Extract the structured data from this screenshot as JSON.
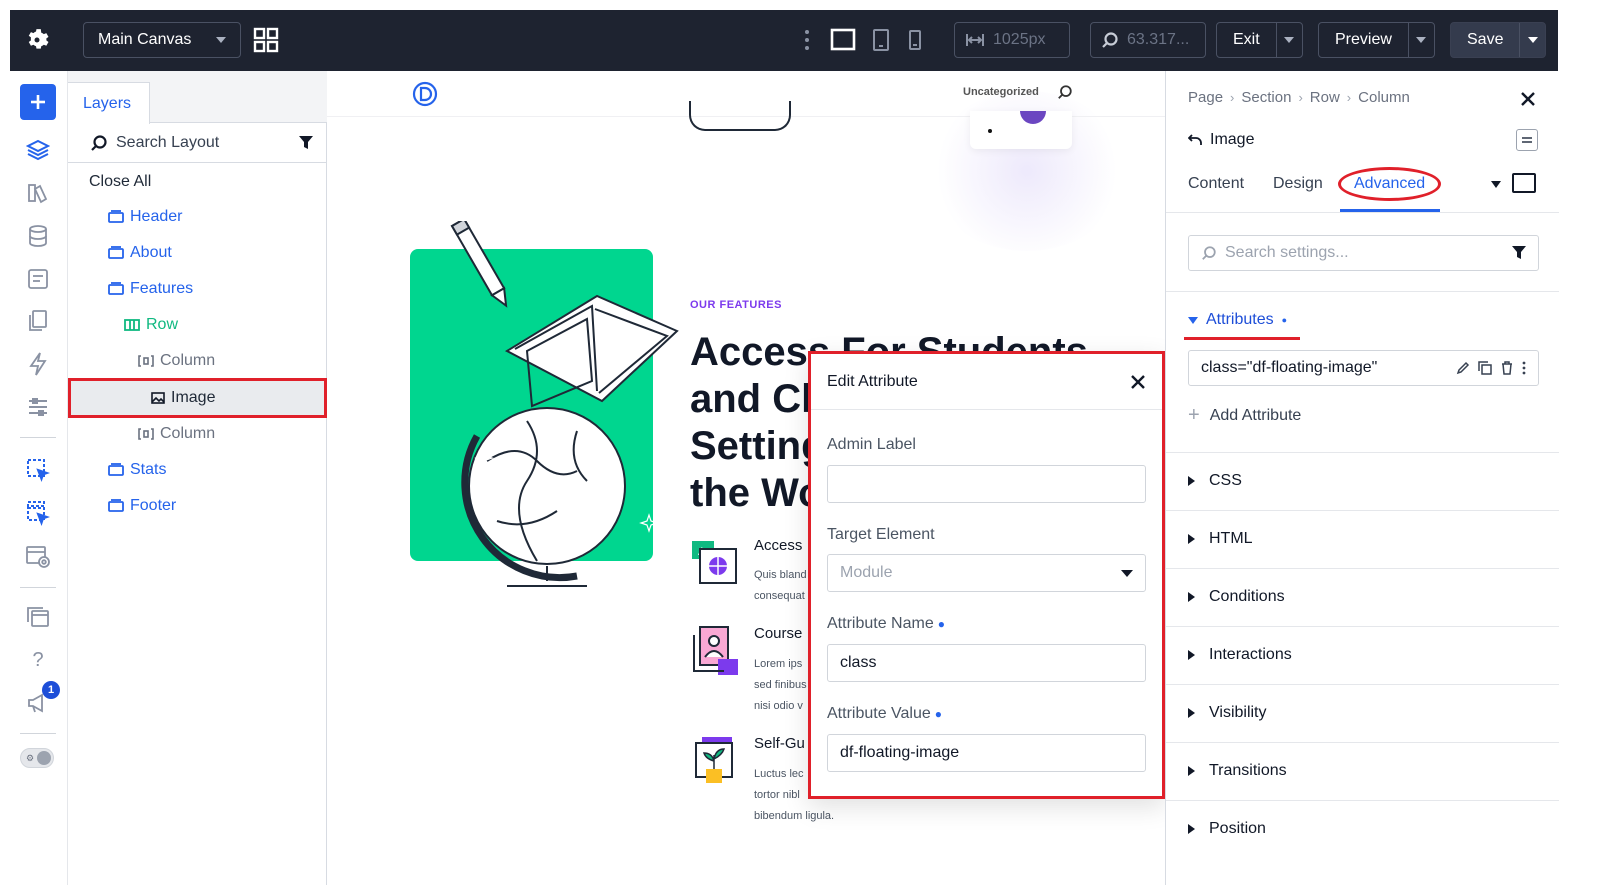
{
  "topbar": {
    "canvas_select": "Main Canvas",
    "width_value": "1025px",
    "zoom_value": "63.317...",
    "exit_label": "Exit",
    "preview_label": "Preview",
    "save_label": "Save"
  },
  "rail": {
    "notification_count": "1",
    "help_label": "?"
  },
  "layers": {
    "tab_label": "Layers",
    "search_placeholder": "Search Layout",
    "close_all": "Close All",
    "items": [
      {
        "label": "Header"
      },
      {
        "label": "About"
      },
      {
        "label": "Features"
      },
      {
        "label": "Row"
      },
      {
        "label": "Column"
      },
      {
        "label": "Image"
      },
      {
        "label": "Column"
      },
      {
        "label": "Stats"
      },
      {
        "label": "Footer"
      }
    ]
  },
  "canvas": {
    "uncategorized": "Uncategorized",
    "eyebrow": "OUR FEATURES",
    "headline_lines": [
      "Access For Students",
      "and Cla",
      "Setting",
      "the Wo"
    ],
    "features": [
      {
        "title": "Access",
        "lines": [
          "Quis bland",
          "consequat"
        ]
      },
      {
        "title": "Course",
        "lines": [
          "Lorem ips",
          "sed finibus",
          "nisi odio v"
        ]
      },
      {
        "title": "Self-Gu",
        "lines": [
          "Luctus lec",
          "tortor nibl",
          "bibendum ligula."
        ]
      }
    ]
  },
  "modal": {
    "title": "Edit Attribute",
    "admin_label": "Admin Label",
    "admin_value": "",
    "target_label": "Target Element",
    "target_value": "Module",
    "name_label": "Attribute Name",
    "name_value": "class",
    "value_label": "Attribute Value",
    "value_value": "df-floating-image"
  },
  "settings": {
    "breadcrumb": [
      "Page",
      "Section",
      "Row",
      "Column"
    ],
    "module_title": "Image",
    "tabs": [
      "Content",
      "Design",
      "Advanced"
    ],
    "search_placeholder": "Search settings...",
    "attributes_label": "Attributes",
    "attribute_entry": "class=\"df-floating-image\"",
    "add_attribute": "Add Attribute",
    "sections": [
      "CSS",
      "HTML",
      "Conditions",
      "Interactions",
      "Visibility",
      "Transitions",
      "Position"
    ]
  },
  "colors": {
    "topbar_bg": "#1e2330",
    "accent_blue": "#2563eb",
    "highlight_red": "#e0202a",
    "feature_green": "#00d68f",
    "eyebrow_purple": "#7c3aed"
  }
}
